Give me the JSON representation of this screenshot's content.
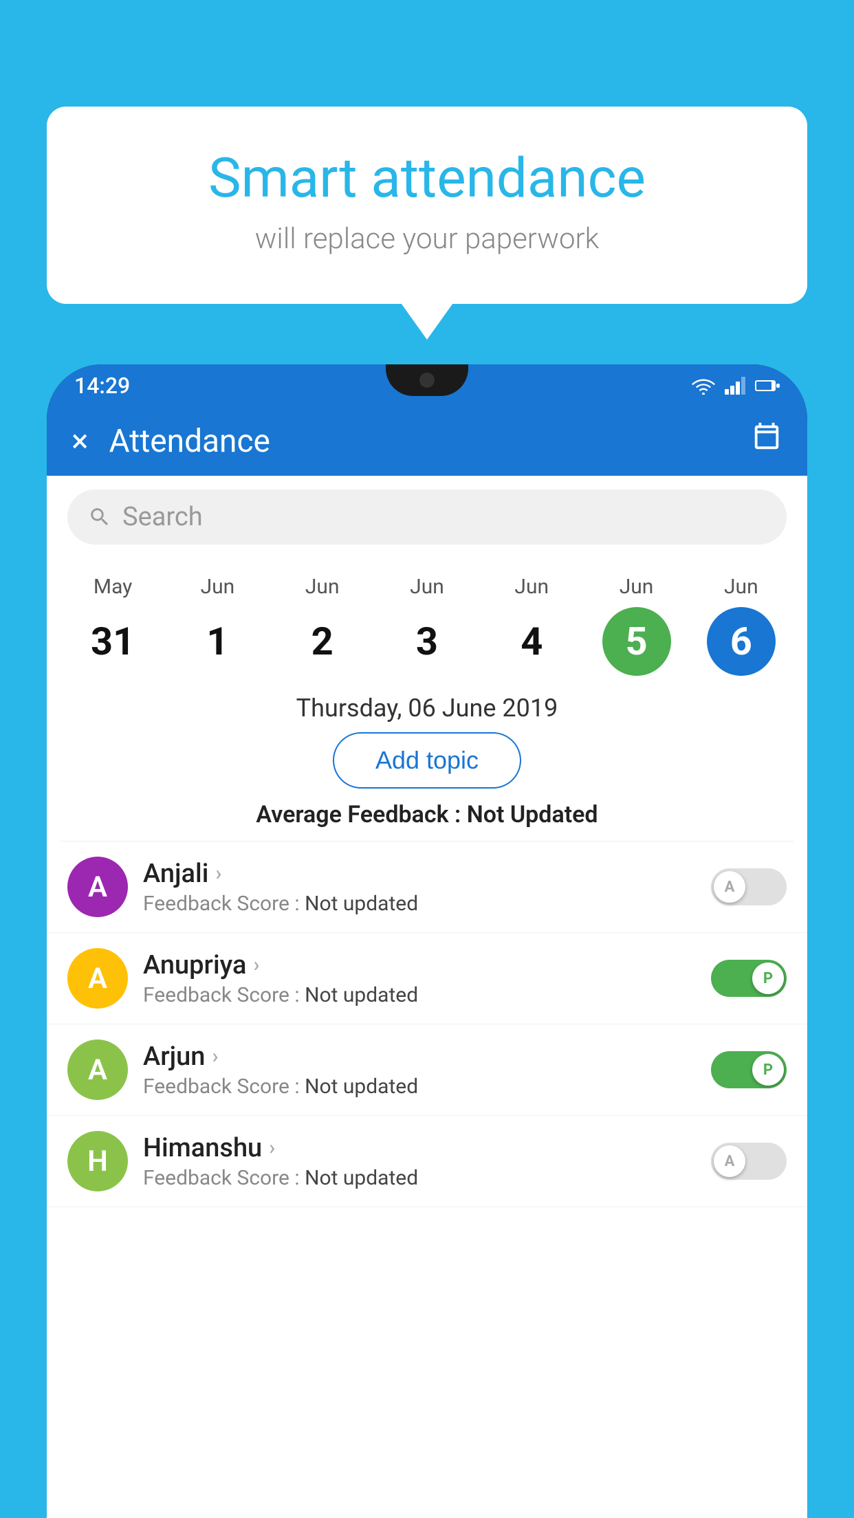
{
  "background_color": "#29b6e8",
  "bubble": {
    "title": "Smart attendance",
    "subtitle": "will replace your paperwork"
  },
  "status_bar": {
    "time": "14:29",
    "wifi_icon": "wifi",
    "signal_icon": "signal",
    "battery_icon": "battery"
  },
  "app_bar": {
    "close_label": "×",
    "title": "Attendance",
    "calendar_icon": "calendar"
  },
  "search": {
    "placeholder": "Search"
  },
  "calendar": {
    "days": [
      {
        "month": "May",
        "day": "31",
        "state": "normal"
      },
      {
        "month": "Jun",
        "day": "1",
        "state": "normal"
      },
      {
        "month": "Jun",
        "day": "2",
        "state": "normal"
      },
      {
        "month": "Jun",
        "day": "3",
        "state": "normal"
      },
      {
        "month": "Jun",
        "day": "4",
        "state": "normal"
      },
      {
        "month": "Jun",
        "day": "5",
        "state": "today"
      },
      {
        "month": "Jun",
        "day": "6",
        "state": "selected"
      }
    ]
  },
  "selected_date": "Thursday, 06 June 2019",
  "add_topic_label": "Add topic",
  "avg_feedback_label": "Average Feedback :",
  "avg_feedback_value": "Not Updated",
  "students": [
    {
      "name": "Anjali",
      "initial": "A",
      "avatar_color": "#9c27b0",
      "feedback_label": "Feedback Score :",
      "feedback_value": "Not updated",
      "toggle_state": "off",
      "toggle_letter": "A"
    },
    {
      "name": "Anupriya",
      "initial": "A",
      "avatar_color": "#ffc107",
      "feedback_label": "Feedback Score :",
      "feedback_value": "Not updated",
      "toggle_state": "on",
      "toggle_letter": "P"
    },
    {
      "name": "Arjun",
      "initial": "A",
      "avatar_color": "#8bc34a",
      "feedback_label": "Feedback Score :",
      "feedback_value": "Not updated",
      "toggle_state": "on",
      "toggle_letter": "P"
    },
    {
      "name": "Himanshu",
      "initial": "H",
      "avatar_color": "#8bc34a",
      "feedback_label": "Feedback Score :",
      "feedback_value": "Not updated",
      "toggle_state": "off",
      "toggle_letter": "A"
    }
  ]
}
